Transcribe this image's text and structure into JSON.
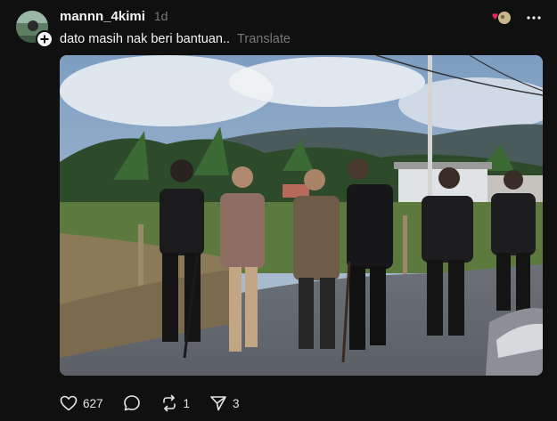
{
  "post": {
    "username": "mannn_4kimi",
    "timestamp": "1d",
    "caption": "dato masih nak beri bantuan..",
    "translate_label": "Translate",
    "image": {
      "description_icon": "photo-of-elderly-men-walking-with-canes-escorted-by-guards"
    }
  },
  "icons": {
    "avatar": "user-avatar",
    "follow": "plus-icon",
    "reaction": "heart-reaction-icon",
    "more": "more-icon",
    "like": "heart-icon",
    "reply": "comment-icon",
    "repost": "repost-icon",
    "share": "send-icon"
  },
  "stats": {
    "likes": "627",
    "reposts": "1",
    "shares": "3"
  },
  "colors": {
    "background": "#101010",
    "text": "#f3f5f7",
    "muted": "#777777",
    "reaction_red": "#e0245e"
  }
}
